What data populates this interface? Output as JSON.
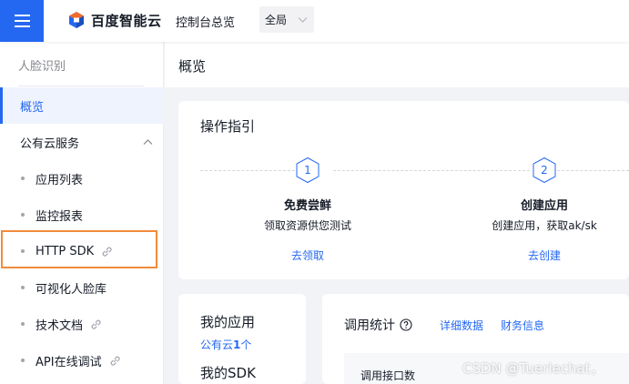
{
  "header": {
    "brand_name": "百度智能云",
    "nav_overview": "控制台总览",
    "region": "全局"
  },
  "sidebar": {
    "title": "人脸识别",
    "items": [
      {
        "label": "概览",
        "active": true
      },
      {
        "label": "公有云服务",
        "group": true
      },
      {
        "label": "应用列表"
      },
      {
        "label": "监控报表"
      },
      {
        "label": "HTTP SDK",
        "external": true
      },
      {
        "label": "可视化人脸库"
      },
      {
        "label": "技术文档",
        "external": true
      },
      {
        "label": "API在线调试",
        "external": true
      }
    ]
  },
  "main": {
    "page_title": "概览",
    "guide": {
      "title": "操作指引",
      "steps": [
        {
          "number": "1",
          "title": "免费尝鲜",
          "desc": "领取资源供您测试",
          "link": "去领取"
        },
        {
          "number": "2",
          "title": "创建应用",
          "desc": "创建应用，获取ak/sk",
          "link": "去创建"
        }
      ]
    },
    "my_app": {
      "title": "我的应用",
      "count_prefix": "公有云",
      "count": "1",
      "count_suffix": "个",
      "sdk_title": "我的SDK"
    },
    "stats": {
      "title": "调用统计",
      "detail_link": "详细数据",
      "finance_link": "财务信息",
      "sub_label": "调用接口数"
    }
  },
  "watermark": "CSDN @Tuerlechat，",
  "colors": {
    "primary": "#2468f2",
    "highlight": "#f28b3b",
    "background": "#f1f3f6"
  }
}
